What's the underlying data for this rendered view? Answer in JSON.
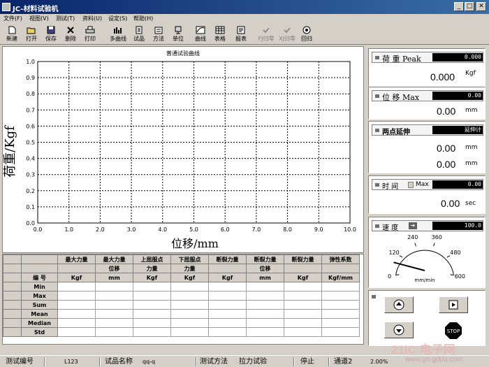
{
  "window": {
    "title": "JC-材料试验机",
    "min": "_",
    "max": "□",
    "close": "✕"
  },
  "menu": [
    "文件(F)",
    "视图(V)",
    "测试(T)",
    "资料(U)",
    "设定(S)",
    "帮助(H)"
  ],
  "toolbar": [
    {
      "label": "新建",
      "icon": "new-icon"
    },
    {
      "label": "打开",
      "icon": "open-icon"
    },
    {
      "label": "保存",
      "icon": "save-icon"
    },
    {
      "label": "删除",
      "icon": "delete-icon"
    },
    {
      "label": "打印",
      "icon": "print-icon"
    },
    {
      "label": "多曲线",
      "icon": "multi-curve-icon"
    },
    {
      "label": "试品",
      "icon": "specimen-icon"
    },
    {
      "label": "方法",
      "icon": "method-icon"
    },
    {
      "label": "单位",
      "icon": "unit-icon"
    },
    {
      "label": "曲线",
      "icon": "curve-icon"
    },
    {
      "label": "表格",
      "icon": "table-icon"
    },
    {
      "label": "报表",
      "icon": "report-icon"
    },
    {
      "label": "FJ归零",
      "icon": "force-zero-icon",
      "disabled": true
    },
    {
      "label": "XJ归零",
      "icon": "disp-zero-icon",
      "disabled": true
    },
    {
      "label": "回归",
      "icon": "return-icon"
    }
  ],
  "chart_data": {
    "type": "line",
    "title": "普通试验曲线",
    "xlabel": "位移/mm",
    "ylabel": "荷重/Kgf",
    "xlim": [
      0,
      10
    ],
    "ylim": [
      0,
      1
    ],
    "xticks": [
      "0.0",
      "1.0",
      "2.0",
      "3.0",
      "4.0",
      "5.0",
      "6.0",
      "7.0",
      "8.0",
      "9.0",
      "10.0"
    ],
    "yticks": [
      "0.0",
      "0.1",
      "0.2",
      "0.3",
      "0.4",
      "0.5",
      "0.6",
      "0.7",
      "0.8",
      "0.9",
      "1.0"
    ],
    "grid": true,
    "series": []
  },
  "panels": {
    "peak": {
      "label": "荷 重 Peak",
      "box": "0.000",
      "value": "0.000",
      "unit": "Kgf"
    },
    "max": {
      "label": "位 移 Max",
      "box": "0.00",
      "value": "0.00",
      "unit": "mm"
    },
    "ext": {
      "label": "两点延伸",
      "box": "延伸计",
      "value1": "0.00",
      "value2": "0.00",
      "unit": "mm"
    },
    "time": {
      "label": "时 间",
      "mode": "Max",
      "box": "0.00",
      "value": "0.00",
      "unit": "sec"
    },
    "speed": {
      "label": "速 度",
      "box": "100.0",
      "gauge_ticks": [
        "0",
        "120",
        "240",
        "360",
        "480",
        "600"
      ],
      "gauge_unit": "mm/min",
      "gauge_value_fraction": 0.12
    }
  },
  "table": {
    "headers1": [
      "最大力量",
      "最大力量",
      "上屈服点",
      "下屈服点",
      "断裂力量",
      "断裂力量",
      "断裂力量",
      "弹性系数"
    ],
    "headers2": [
      "",
      "位移",
      "力量",
      "力量",
      "",
      "位移",
      "",
      ""
    ],
    "rowlabel_header": "编 号",
    "units": [
      "Kgf",
      "mm",
      "Kgf",
      "Kgf",
      "Kgf",
      "mm",
      "Kgf",
      "Kgf/mm"
    ],
    "rows": [
      "Min",
      "Max",
      "Sum",
      "Mean",
      "Median",
      "Std"
    ]
  },
  "status": {
    "test_no_label": "测试编号",
    "test_no": "L123",
    "specimen_label": "试品名称",
    "specimen": "qq-q",
    "method_label": "测试方法",
    "method": "拉力试验",
    "state": "停止",
    "channel": "通道2",
    "extra": "2.00%"
  },
  "watermark": {
    "brand": "21IC 电子网",
    "url": "www.go-gddq.com"
  },
  "colors": {
    "titlebar": "#0a246a",
    "panel_bg": "#d4d0c8",
    "grid": "#000000"
  }
}
